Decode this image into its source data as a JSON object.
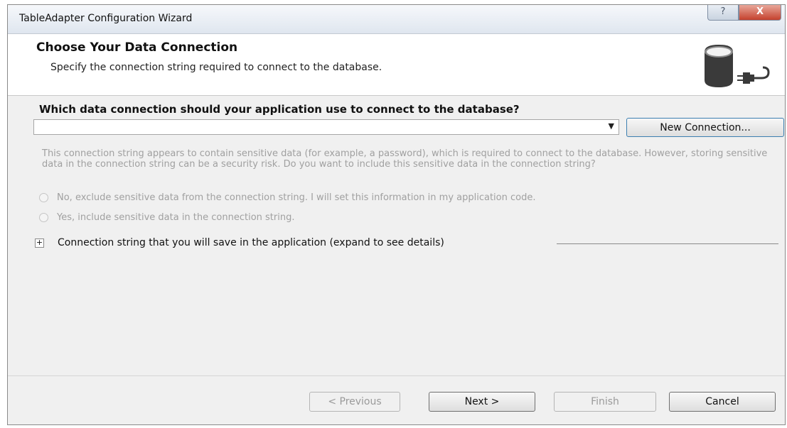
{
  "window": {
    "title": "TableAdapter Configuration Wizard",
    "help_label": "?",
    "close_label": "X"
  },
  "header": {
    "title": "Choose Your Data Connection",
    "subtitle": "Specify the connection string required to connect to the database.",
    "icon": "database-plug-icon"
  },
  "connection": {
    "question": "Which data connection should your application use to connect to the database?",
    "selected_value": "",
    "new_connection_label": "New Connection..."
  },
  "sensitive_data": {
    "message": "This connection string appears to contain sensitive data (for example, a password), which is required to connect to the database. However, storing sensitive data in the connection string can be a security risk. Do you want to include this sensitive data in the connection string?",
    "option_no": "No, exclude sensitive data from the connection string. I will set this information in my application code.",
    "option_yes": "Yes, include sensitive data in the connection string."
  },
  "expander": {
    "symbol": "+",
    "label": "Connection string that you will save in the application (expand to see details)"
  },
  "footer": {
    "previous_label": "< Previous",
    "next_label": "Next >",
    "finish_label": "Finish",
    "cancel_label": "Cancel"
  }
}
